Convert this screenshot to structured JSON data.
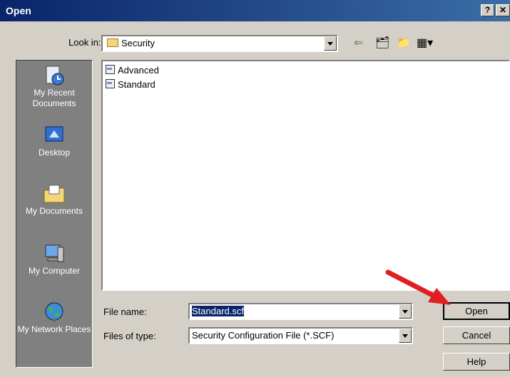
{
  "window": {
    "title": "Open"
  },
  "lookin": {
    "label": "Look in:",
    "value": "Security"
  },
  "places": [
    {
      "id": "recent",
      "label": "My Recent Documents"
    },
    {
      "id": "desktop",
      "label": "Desktop"
    },
    {
      "id": "mydocs",
      "label": "My Documents"
    },
    {
      "id": "computer",
      "label": "My Computer"
    },
    {
      "id": "network",
      "label": "My Network Places"
    }
  ],
  "files": [
    "Advanced",
    "Standard"
  ],
  "filename": {
    "label": "File name:",
    "value": "Standard.scf"
  },
  "filetype": {
    "label": "Files of type:",
    "value": "Security Configuration File (*.SCF)"
  },
  "buttons": {
    "open": "Open",
    "cancel": "Cancel",
    "help": "Help"
  },
  "colors": {
    "title_bar": "#0a246a",
    "places_bar": "#808080",
    "arrow": "#e02020"
  }
}
